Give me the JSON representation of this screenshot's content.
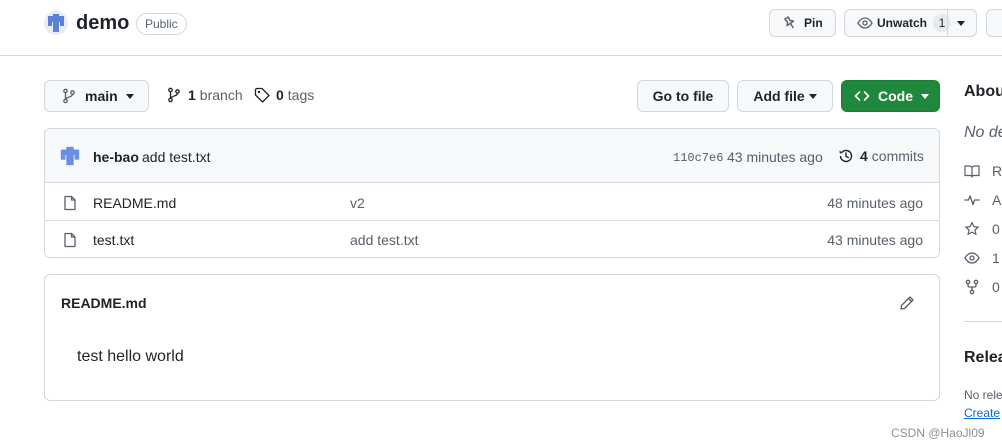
{
  "repo": {
    "name": "demo",
    "visibility": "Public",
    "avatar_icon": "identicon-blue"
  },
  "header_actions": {
    "pin_label": "Pin",
    "unwatch_label": "Unwatch",
    "watch_count": "1"
  },
  "toolbar": {
    "branch_name": "main",
    "branch_count": "1",
    "branch_label": "branch",
    "tag_count": "0",
    "tag_label": "tags",
    "go_to_file": "Go to file",
    "add_file": "Add file",
    "code": "Code"
  },
  "latest_commit": {
    "author": "he-bao",
    "message": "add test.txt",
    "sha": "110c7e6",
    "time": "43 minutes ago",
    "commit_count": "4",
    "commit_label": "commits"
  },
  "files": [
    {
      "name": "README.md",
      "commit_message": "v2",
      "time": "48 minutes ago"
    },
    {
      "name": "test.txt",
      "commit_message": "add test.txt",
      "time": "43 minutes ago"
    }
  ],
  "readme": {
    "title": "README.md",
    "content": "test hello world"
  },
  "sidebar": {
    "about_title": "Abou",
    "description": "No de",
    "rows": [
      {
        "icon": "book-icon",
        "text": "R"
      },
      {
        "icon": "pulse-icon",
        "text": "A"
      },
      {
        "icon": "star-icon",
        "text": "0"
      },
      {
        "icon": "eye-icon",
        "text": "1"
      },
      {
        "icon": "fork-icon",
        "text": "0"
      }
    ],
    "releases_title": "Relea",
    "no_releases": "No rele",
    "create_link": "Create"
  },
  "watermark": "CSDN @HaoJl09",
  "colors": {
    "primary_button": "#1f883d",
    "border": "#d0d7de",
    "muted_text": "#57606a",
    "link": "#0969da"
  }
}
